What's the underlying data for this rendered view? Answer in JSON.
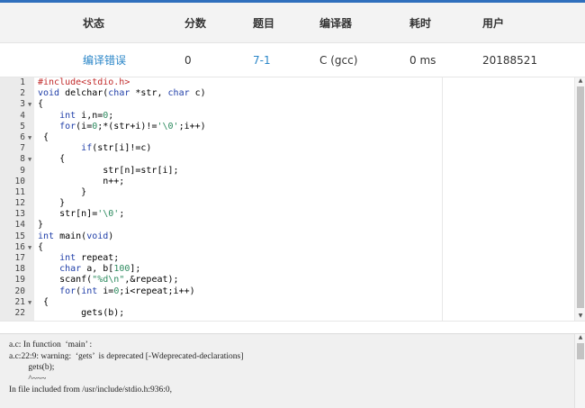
{
  "table": {
    "headers": [
      "状态",
      "分数",
      "题目",
      "编译器",
      "耗时",
      "用户"
    ],
    "row": {
      "status": "编译错误",
      "score": "0",
      "problem": "7-1",
      "compiler": "C (gcc)",
      "time": "0 ms",
      "user": "20188521"
    }
  },
  "editor": {
    "lines": [
      {
        "n": "1",
        "fold": false,
        "code": [
          [
            "inc",
            "#include<stdio.h>"
          ]
        ]
      },
      {
        "n": "2",
        "fold": false,
        "code": [
          [
            "kw",
            "void"
          ],
          [
            "",
            " delchar("
          ],
          [
            "kw",
            "char"
          ],
          [
            "",
            " *str, "
          ],
          [
            "kw",
            "char"
          ],
          [
            "",
            " c)"
          ]
        ]
      },
      {
        "n": "3",
        "fold": true,
        "code": [
          [
            "",
            "{"
          ]
        ]
      },
      {
        "n": "4",
        "fold": false,
        "code": [
          [
            "",
            "    "
          ],
          [
            "kw",
            "int"
          ],
          [
            "",
            " i,n="
          ],
          [
            "num",
            "0"
          ],
          [
            "",
            ";"
          ]
        ]
      },
      {
        "n": "5",
        "fold": false,
        "code": [
          [
            "",
            "    "
          ],
          [
            "kw",
            "for"
          ],
          [
            "",
            "(i="
          ],
          [
            "num",
            "0"
          ],
          [
            "",
            ";*(str+i)!="
          ],
          [
            "str",
            "'\\0'"
          ],
          [
            "",
            ";i++)"
          ]
        ]
      },
      {
        "n": "6",
        "fold": true,
        "code": [
          [
            "",
            " {"
          ]
        ]
      },
      {
        "n": "7",
        "fold": false,
        "code": [
          [
            "",
            "        "
          ],
          [
            "kw",
            "if"
          ],
          [
            "",
            "(str[i]!=c)"
          ]
        ]
      },
      {
        "n": "8",
        "fold": true,
        "code": [
          [
            "",
            "    {"
          ]
        ]
      },
      {
        "n": "9",
        "fold": false,
        "code": [
          [
            "",
            "            str[n]=str[i];"
          ]
        ]
      },
      {
        "n": "10",
        "fold": false,
        "code": [
          [
            "",
            "            n++;"
          ]
        ]
      },
      {
        "n": "11",
        "fold": false,
        "code": [
          [
            "",
            "        }"
          ]
        ]
      },
      {
        "n": "12",
        "fold": false,
        "code": [
          [
            "",
            "    }"
          ]
        ]
      },
      {
        "n": "13",
        "fold": false,
        "code": [
          [
            "",
            "    str[n]="
          ],
          [
            "str",
            "'\\0'"
          ],
          [
            "",
            ";"
          ]
        ]
      },
      {
        "n": "14",
        "fold": false,
        "code": [
          [
            "",
            "}"
          ]
        ]
      },
      {
        "n": "15",
        "fold": false,
        "code": [
          [
            "kw",
            "int"
          ],
          [
            "",
            " main("
          ],
          [
            "kw",
            "void"
          ],
          [
            "",
            ")"
          ]
        ]
      },
      {
        "n": "16",
        "fold": true,
        "code": [
          [
            "",
            "{"
          ]
        ]
      },
      {
        "n": "17",
        "fold": false,
        "code": [
          [
            "",
            "    "
          ],
          [
            "kw",
            "int"
          ],
          [
            "",
            " repeat;"
          ]
        ]
      },
      {
        "n": "18",
        "fold": false,
        "code": [
          [
            "",
            "    "
          ],
          [
            "kw",
            "char"
          ],
          [
            "",
            " a, b["
          ],
          [
            "num",
            "100"
          ],
          [
            "",
            "];"
          ]
        ]
      },
      {
        "n": "19",
        "fold": false,
        "code": [
          [
            "",
            "    scanf("
          ],
          [
            "str",
            "\"%d\\n\""
          ],
          [
            "",
            ",&repeat);"
          ]
        ]
      },
      {
        "n": "20",
        "fold": false,
        "code": [
          [
            "",
            "    "
          ],
          [
            "kw",
            "for"
          ],
          [
            "",
            "("
          ],
          [
            "kw",
            "int"
          ],
          [
            "",
            " i="
          ],
          [
            "num",
            "0"
          ],
          [
            "",
            ";i<repeat;i++)"
          ]
        ]
      },
      {
        "n": "21",
        "fold": true,
        "code": [
          [
            "",
            " {"
          ]
        ]
      },
      {
        "n": "22",
        "fold": false,
        "code": [
          [
            "",
            "        gets(b);"
          ]
        ]
      }
    ]
  },
  "output": {
    "lines": [
      "a.c: In function  ‘main’ :",
      "a.c:22:9: warning:  ‘gets’  is deprecated [-Wdeprecated-declarations]",
      "         gets(b);",
      "         ^~~~",
      "In file included from /usr/include/stdio.h:936:0,"
    ]
  },
  "icons": {
    "fold": "fold-arrow-icon",
    "scroll_up": "scroll-up-arrow-icon",
    "scroll_down": "scroll-down-arrow-icon"
  },
  "colors": {
    "accent": "#2f6fbd",
    "status_link": "#2a86c8",
    "keyword": "#1f3ea8",
    "literal": "#2c8a5e",
    "include": "#c12a2a"
  }
}
